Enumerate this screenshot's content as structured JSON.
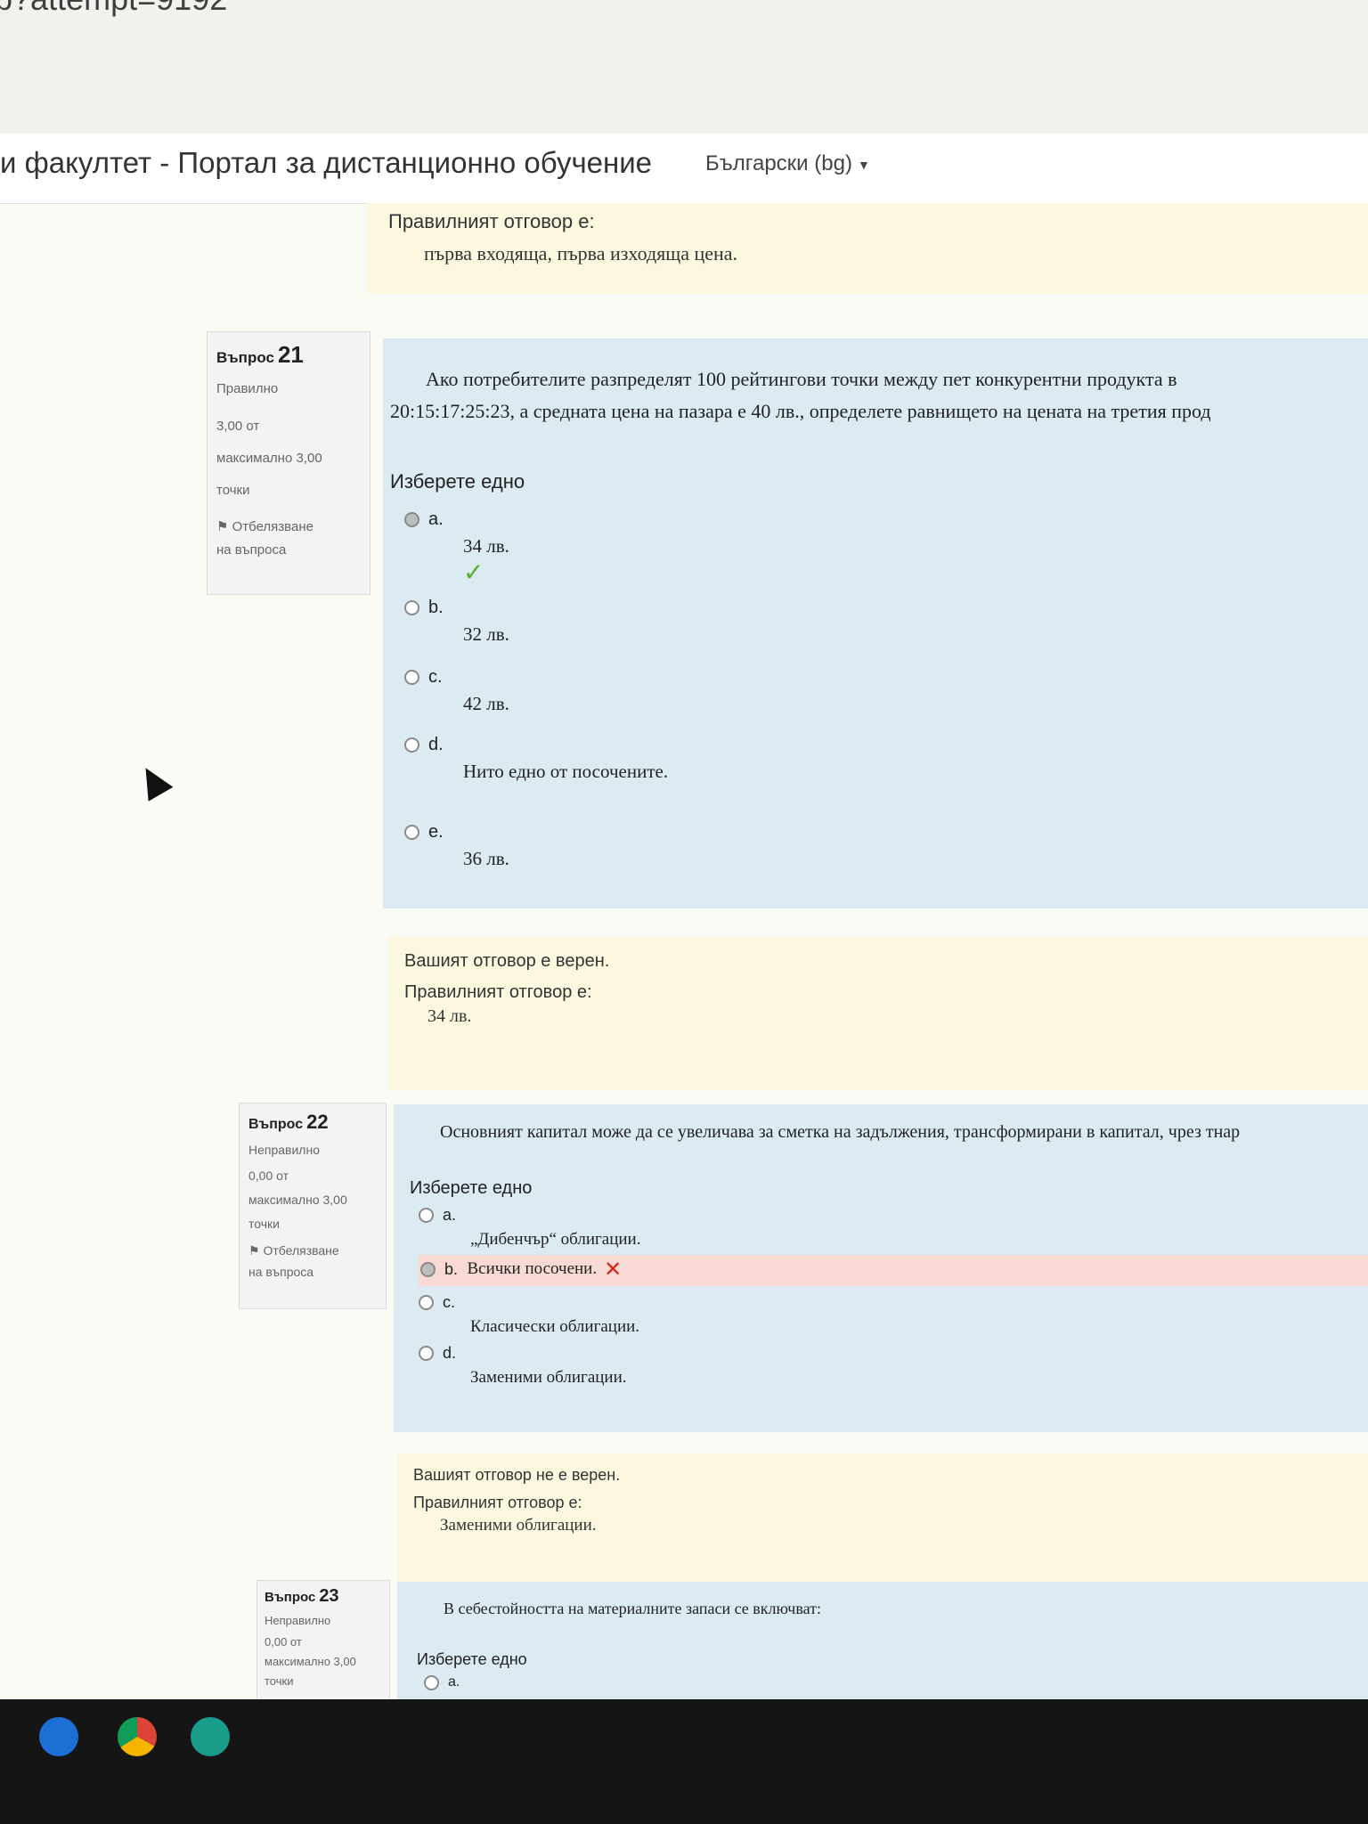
{
  "browser": {
    "url_fragment": "p?attempt=9192"
  },
  "header": {
    "site_title": "и факултет - Портал за дистанционно обучение",
    "language": "Български (bg)"
  },
  "q20_feedback": {
    "correct_label": "Правилният отговор е:",
    "correct_answer": "първа входяща, първа изходяща цена."
  },
  "q21": {
    "label": "Въпрос",
    "number": "21",
    "state": "Правилно",
    "grade_line1": "3,00 от",
    "grade_line2": "максимално 3,00",
    "grade_line3": "точки",
    "flag_line1": "Отбелязване",
    "flag_line2": "на въпроса",
    "text_line1": "Ако потребителите разпределят 100 рейтингови точки между пет конкурентни продукта в",
    "text_line2": "20:15:17:25:23, а средната цена на пазара е 40 лв., определете равнището на цената на третия прод",
    "prompt": "Изберете едно",
    "options": [
      {
        "letter": "a.",
        "text": "34 лв."
      },
      {
        "letter": "b.",
        "text": "32 лв."
      },
      {
        "letter": "c.",
        "text": "42 лв."
      },
      {
        "letter": "d.",
        "text": "Нито едно от посочените."
      },
      {
        "letter": "e.",
        "text": "36 лв."
      }
    ],
    "feedback_result": "Вашият отговор е верен.",
    "feedback_label": "Правилният отговор е:",
    "feedback_answer": "34 лв."
  },
  "q22": {
    "label": "Въпрос",
    "number": "22",
    "state": "Неправилно",
    "grade_line1": "0,00 от",
    "grade_line2": "максимално 3,00",
    "grade_line3": "точки",
    "flag_line1": "Отбелязване",
    "flag_line2": "на въпроса",
    "text": "Основният капитал може да се увеличава за сметка на задължения, трансформирани в капитал, чрез тнар",
    "prompt": "Изберете едно",
    "options": [
      {
        "letter": "a.",
        "text": "„Дибенчър“ облигации."
      },
      {
        "letter": "b.",
        "text": "Всички посочени."
      },
      {
        "letter": "c.",
        "text": "Класически облигации."
      },
      {
        "letter": "d.",
        "text": "Заменими облигации."
      }
    ],
    "feedback_result": "Вашият отговор не е верен.",
    "feedback_label": "Правилният отговор е:",
    "feedback_answer": "Заменими облигации."
  },
  "q23": {
    "label": "Въпрос",
    "number": "23",
    "state": "Неправилно",
    "grade_line1": "0,00 от",
    "grade_line2": "максимално 3,00",
    "grade_line3": "точки",
    "text": "В себестойността на материалните запаси се включват:",
    "prompt": "Изберете едно",
    "option_a_letter": "a."
  },
  "colors": {
    "feedback_bg": "#fcf8e0",
    "formulation_bg": "#dcebf2",
    "incorrect_bg": "#f8d9d3",
    "tick": "#5aaf2a",
    "cross": "#d9261c"
  }
}
